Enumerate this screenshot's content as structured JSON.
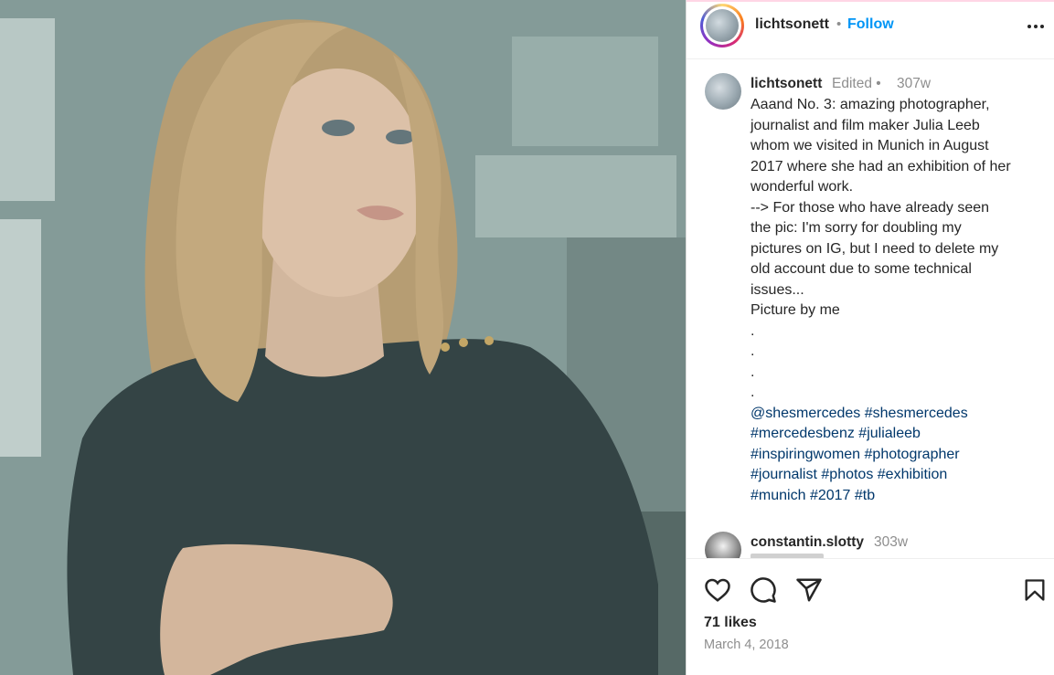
{
  "post": {
    "photo_alt": "",
    "header": {
      "username": "lichtsonett",
      "separator": "•",
      "follow_label": "Follow",
      "more_icon": "more-options-icon"
    },
    "caption": {
      "username": "lichtsonett",
      "edited_label": "Edited •",
      "time": "307w",
      "lines": [
        "Aaand No. 3: amazing photographer,",
        "journalist and film maker Julia Leeb",
        "whom we visited in Munich in August",
        "2017 where she had an exhibition of her",
        "wonderful work.",
        "--> For those who have already seen",
        "the pic: I'm sorry for doubling my",
        "pictures on IG, but I need to delete my",
        "old account due to some technical",
        "issues...",
        "Picture by me",
        ".",
        ".",
        ".",
        "."
      ],
      "hashtag_lines": [
        [
          "@shesmercedes",
          "#shesmercedes"
        ],
        [
          "#mercedesbenz",
          "#julialeeb"
        ],
        [
          "#inspiringwomen",
          "#photographer"
        ],
        [
          "#journalist",
          "#photos",
          "#exhibition"
        ],
        [
          "#munich",
          "#2017",
          "#tb"
        ]
      ]
    },
    "comment": {
      "username": "constantin.slotty",
      "time": "303w"
    },
    "actions": {
      "like_icon": "heart-icon",
      "comment_icon": "comment-icon",
      "share_icon": "share-icon",
      "save_icon": "bookmark-icon"
    },
    "likes": "71 likes",
    "date": "March 4, 2018"
  },
  "colors": {
    "accent": "#0095f6",
    "hashtag": "#00376b",
    "muted": "#8e8e8e",
    "text": "#262626"
  }
}
